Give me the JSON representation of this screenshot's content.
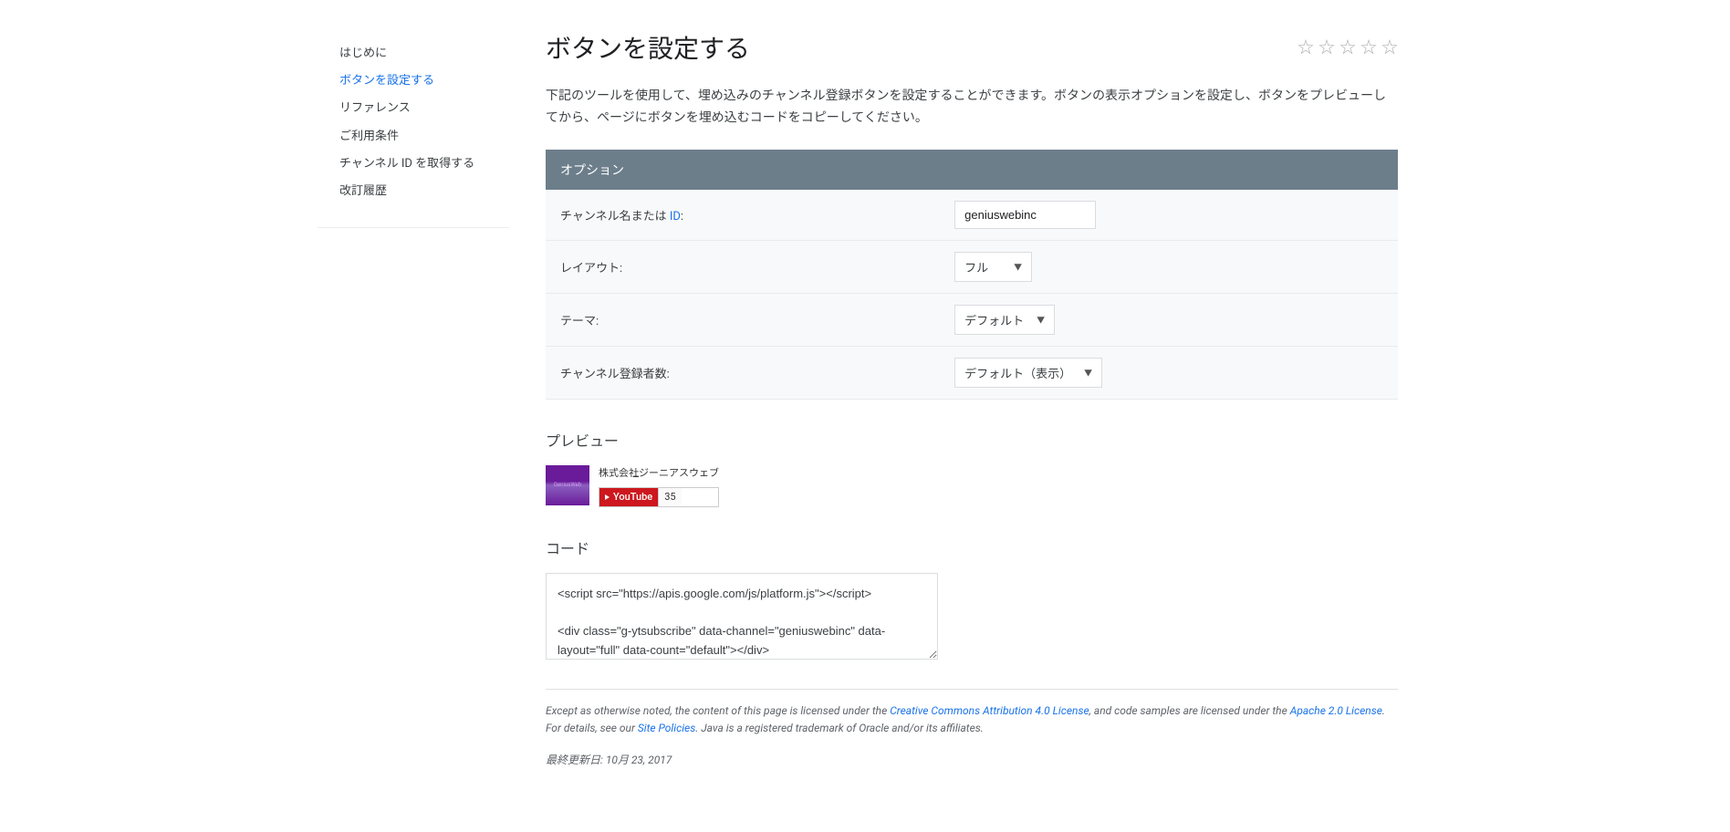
{
  "sidebar": {
    "items": [
      {
        "label": "はじめに"
      },
      {
        "label": "ボタンを設定する"
      },
      {
        "label": "リファレンス"
      },
      {
        "label": "ご利用条件"
      },
      {
        "label": "チャンネル ID を取得する"
      },
      {
        "label": "改訂履歴"
      }
    ]
  },
  "title": "ボタンを設定する",
  "intro": "下記のツールを使用して、埋め込みのチャンネル登録ボタンを設定することができます。ボタンの表示オプションを設定し、ボタンをプレビューしてから、ページにボタンを埋め込むコードをコピーしてください。",
  "options": {
    "header": "オプション",
    "channel_label_prefix": "チャンネル名または ",
    "channel_label_link": "ID",
    "channel_label_colon": ":",
    "channel_value": "geniuswebinc",
    "layout_label": "レイアウト:",
    "layout_value": "フル",
    "theme_label": "テーマ:",
    "theme_value": "デフォルト",
    "subs_label": "チャンネル登録者数:",
    "subs_value": "デフォルト（表示）"
  },
  "preview": {
    "heading": "プレビュー",
    "thumb_text": "GeniusWeb",
    "channel_name": "株式会社ジーニアスウェブ",
    "youtube_label": "YouTube",
    "sub_count": "35"
  },
  "code": {
    "heading": "コード",
    "content": "<script src=\"https://apis.google.com/js/platform.js\"></script>\n\n<div class=\"g-ytsubscribe\" data-channel=\"geniuswebinc\" data-layout=\"full\" data-count=\"default\"></div>"
  },
  "license": {
    "prefix": "Except as otherwise noted, the content of this page is licensed under the ",
    "cc_link": "Creative Commons Attribution 4.0 License",
    "mid1": ", and code samples are licensed under the ",
    "apache_link": "Apache 2.0 License",
    "mid2": ". For details, see our ",
    "policies_link": "Site Policies",
    "suffix": ". Java is a registered trademark of Oracle and/or its affiliates."
  },
  "last_updated": "最終更新日: 10月 23, 2017"
}
